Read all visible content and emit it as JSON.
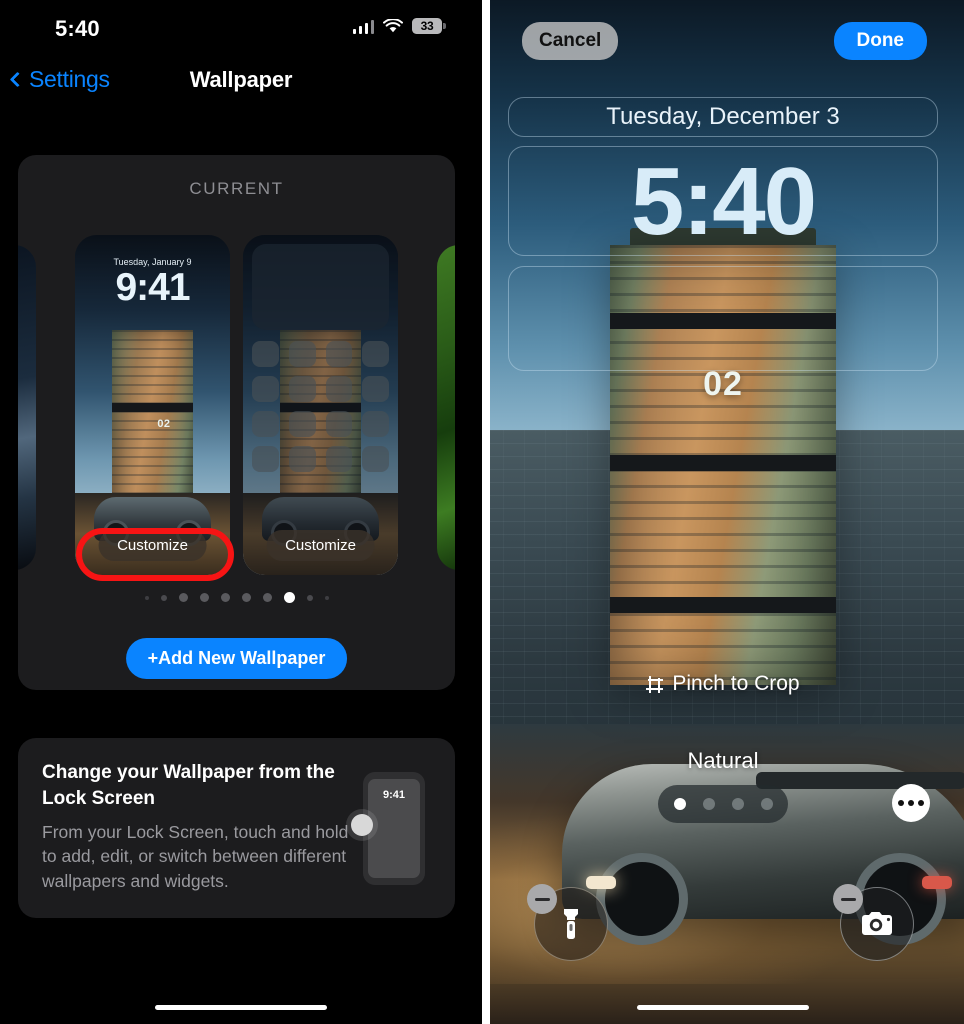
{
  "left": {
    "status_bar": {
      "time": "5:40",
      "battery_percent": "33",
      "signal_icon": "cellular-bars-icon",
      "wifi_icon": "wifi-icon",
      "battery_icon": "battery-icon"
    },
    "nav": {
      "back_label": "Settings",
      "title": "Wallpaper",
      "back_icon": "chevron-left-icon"
    },
    "current_section": {
      "header": "CURRENT",
      "previews": [
        {
          "type": "lock-screen",
          "date": "Tuesday, January 9",
          "time": "9:41",
          "building_number": "02",
          "customize_label": "Customize",
          "highlighted": true
        },
        {
          "type": "home-screen",
          "customize_label": "Customize",
          "highlighted": false
        }
      ],
      "page_dots": {
        "count": 10,
        "active_index": 7
      },
      "add_button": {
        "label": "+Add New Wallpaper",
        "color": "#0a84ff"
      }
    },
    "info_card": {
      "heading": "Change your Wallpaper from the Lock Screen",
      "body": "From your Lock Screen, touch and hold to add, edit, or switch between different wallpapers and widgets.",
      "phone_time": "9:41"
    }
  },
  "right": {
    "cancel_label": "Cancel",
    "done_label": "Done",
    "date_widget": "Tuesday, December 3",
    "time": "5:40",
    "building_number": "02",
    "pinch_hint": "Pinch to Crop",
    "pinch_icon": "crop-icon",
    "filter_name": "Natural",
    "filter_dots": {
      "count": 4,
      "active_index": 0
    },
    "shuffle_icon": "photo-stack-icon",
    "more_icon": "ellipsis-icon",
    "quick_actions": [
      {
        "icon": "flashlight-icon",
        "remove_icon": "minus-badge-icon"
      },
      {
        "icon": "camera-icon",
        "remove_icon": "minus-badge-icon"
      }
    ]
  },
  "annotations": {
    "color": "#f71414",
    "items": [
      {
        "shape": "ellipse",
        "target": "customize-button-left"
      },
      {
        "shape": "rectangle",
        "target": "photo-stack-button"
      },
      {
        "shape": "arrow",
        "target": "photo-stack-button"
      }
    ]
  }
}
